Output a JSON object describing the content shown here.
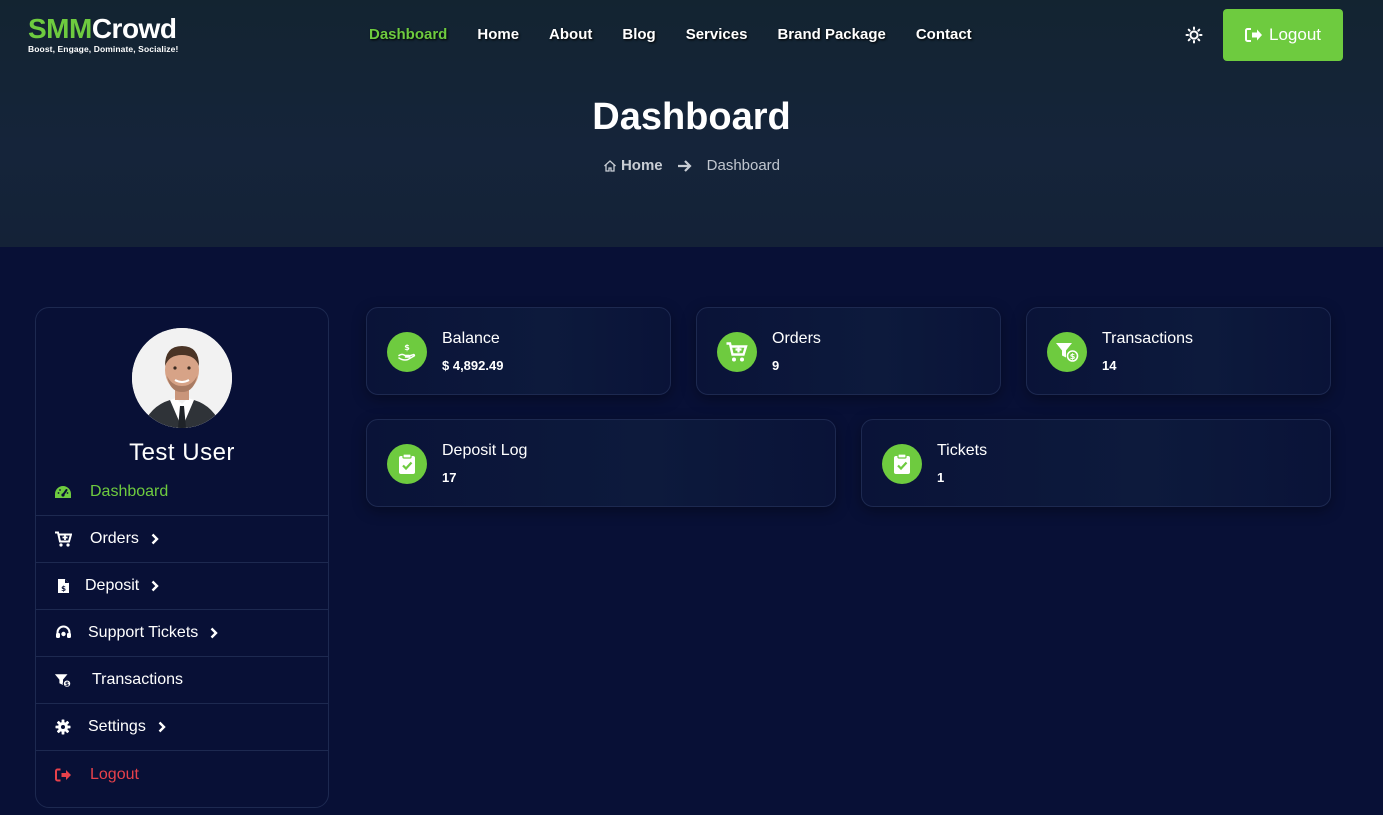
{
  "brand": {
    "name_part1": "SMM",
    "name_part2": "Crowd",
    "tagline": "Boost, Engage, Dominate, Socialize!",
    "accent_color": "#6ecb3f",
    "danger_color": "#e8414b"
  },
  "nav": {
    "items": [
      {
        "label": "Dashboard",
        "active": true
      },
      {
        "label": "Home"
      },
      {
        "label": "About"
      },
      {
        "label": "Blog"
      },
      {
        "label": "Services"
      },
      {
        "label": "Brand Package"
      },
      {
        "label": "Contact"
      }
    ],
    "theme_icon": "sun-icon",
    "logout_label": "Logout"
  },
  "hero": {
    "title": "Dashboard",
    "breadcrumb": {
      "home": "Home",
      "current": "Dashboard"
    }
  },
  "sidebar": {
    "user_name": "Test User",
    "items": [
      {
        "label": "Dashboard",
        "icon": "gauge-icon"
      },
      {
        "label": "Orders",
        "icon": "cart-icon"
      },
      {
        "label": "Deposit",
        "icon": "invoice-icon"
      },
      {
        "label": "Support Tickets",
        "icon": "headset-icon"
      },
      {
        "label": "Transactions",
        "icon": "filter-dollar-icon"
      },
      {
        "label": "Settings",
        "icon": "gear-icon"
      },
      {
        "label": "Logout",
        "icon": "logout-icon"
      }
    ]
  },
  "stats": [
    {
      "label": "Balance",
      "value": "$ 4,892.49",
      "icon": "hand-dollar-icon"
    },
    {
      "label": "Orders",
      "value": "9",
      "icon": "cart-plus-icon"
    },
    {
      "label": "Transactions",
      "value": "14",
      "icon": "filter-dollar-icon"
    },
    {
      "label": "Deposit Log",
      "value": "17",
      "icon": "clipboard-check-icon"
    },
    {
      "label": "Tickets",
      "value": "1",
      "icon": "clipboard-check-icon"
    }
  ]
}
